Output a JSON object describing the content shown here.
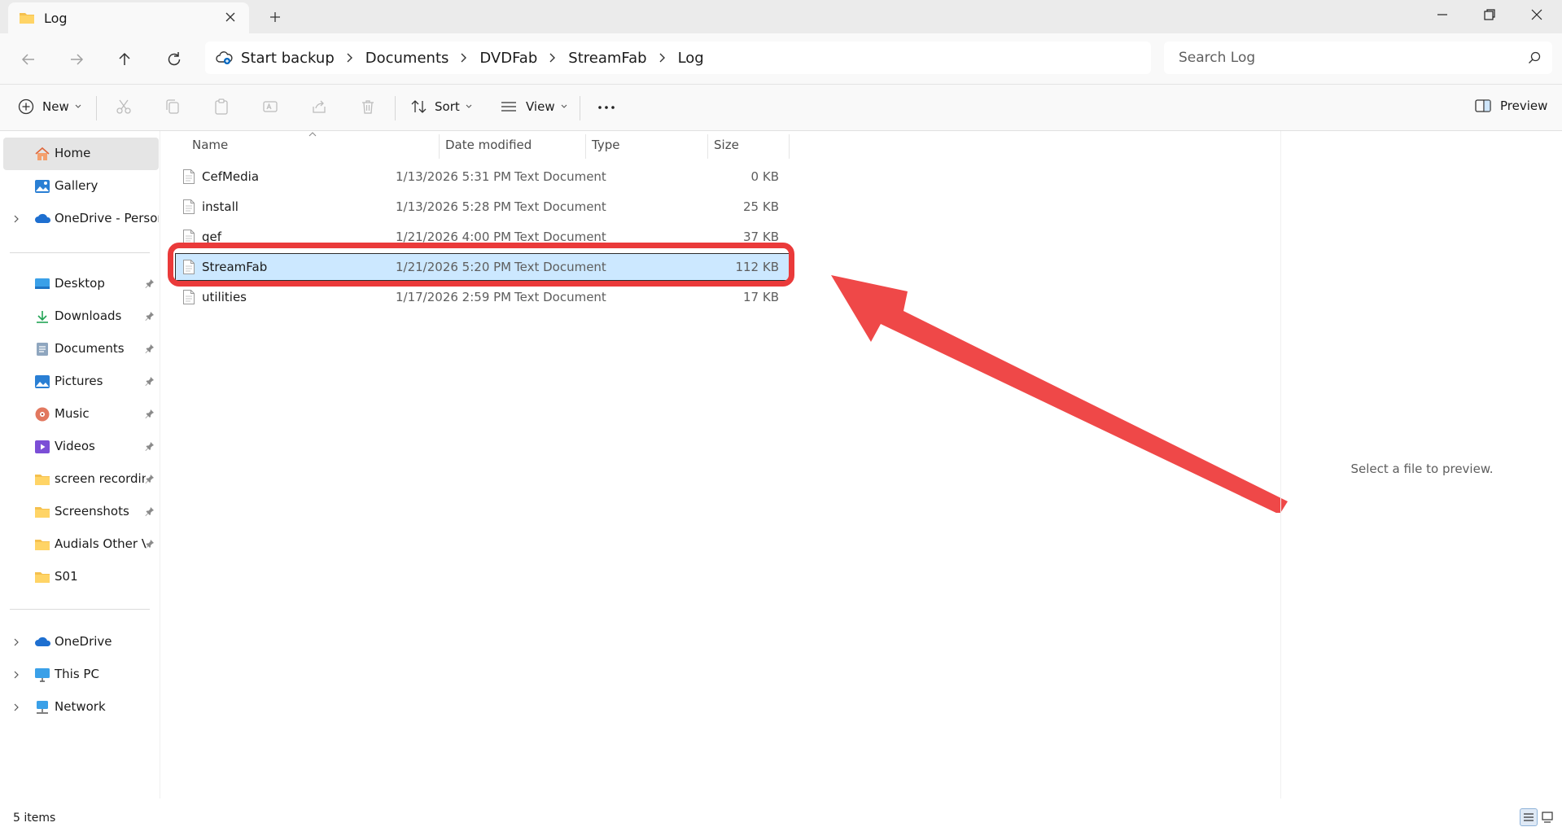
{
  "window": {
    "tab_title": "Log"
  },
  "breadcrumb": {
    "items": [
      "Start backup",
      "Documents",
      "DVDFab",
      "StreamFab",
      "Log"
    ]
  },
  "search": {
    "placeholder": "Search Log"
  },
  "toolbar": {
    "new_label": "New",
    "sort_label": "Sort",
    "view_label": "View",
    "preview_label": "Preview"
  },
  "sidebar": {
    "top": [
      {
        "label": "Home",
        "icon": "home-icon",
        "selected": true
      },
      {
        "label": "Gallery",
        "icon": "gallery-icon"
      },
      {
        "label": "OneDrive - Persona",
        "icon": "onedrive-icon",
        "expandable": true
      }
    ],
    "quick_access": [
      {
        "label": "Desktop",
        "icon": "desktop-icon"
      },
      {
        "label": "Downloads",
        "icon": "downloads-icon"
      },
      {
        "label": "Documents",
        "icon": "documents-icon"
      },
      {
        "label": "Pictures",
        "icon": "pictures-icon"
      },
      {
        "label": "Music",
        "icon": "music-icon"
      },
      {
        "label": "Videos",
        "icon": "videos-icon"
      },
      {
        "label": "screen recording",
        "icon": "folder-icon"
      },
      {
        "label": "Screenshots",
        "icon": "folder-icon"
      },
      {
        "label": "Audials Other Vi",
        "icon": "folder-icon"
      },
      {
        "label": "S01",
        "icon": "folder-icon"
      }
    ],
    "bottom": [
      {
        "label": "OneDrive",
        "icon": "onedrive-icon"
      },
      {
        "label": "This PC",
        "icon": "this-pc-icon"
      },
      {
        "label": "Network",
        "icon": "network-icon"
      }
    ]
  },
  "file_list": {
    "columns": {
      "name": "Name",
      "date": "Date modified",
      "type": "Type",
      "size": "Size"
    },
    "rows": [
      {
        "name": "CefMedia",
        "date": "1/13/2026 5:31 PM",
        "type": "Text Document",
        "size": "0 KB"
      },
      {
        "name": "install",
        "date": "1/13/2026 5:28 PM",
        "type": "Text Document",
        "size": "25 KB"
      },
      {
        "name": "qef",
        "date": "1/21/2026 4:00 PM",
        "type": "Text Document",
        "size": "37 KB"
      },
      {
        "name": "StreamFab",
        "date": "1/21/2026 5:20 PM",
        "type": "Text Document",
        "size": "112 KB",
        "selected": true
      },
      {
        "name": "utilities",
        "date": "1/17/2026 2:59 PM",
        "type": "Text Document",
        "size": "17 KB"
      }
    ]
  },
  "preview": {
    "empty_text": "Select a file to preview."
  },
  "status": {
    "item_count": "5 items"
  },
  "colors": {
    "accent": "#0067c0",
    "selection": "#cce8ff",
    "annotation": "#ea3a3a"
  }
}
